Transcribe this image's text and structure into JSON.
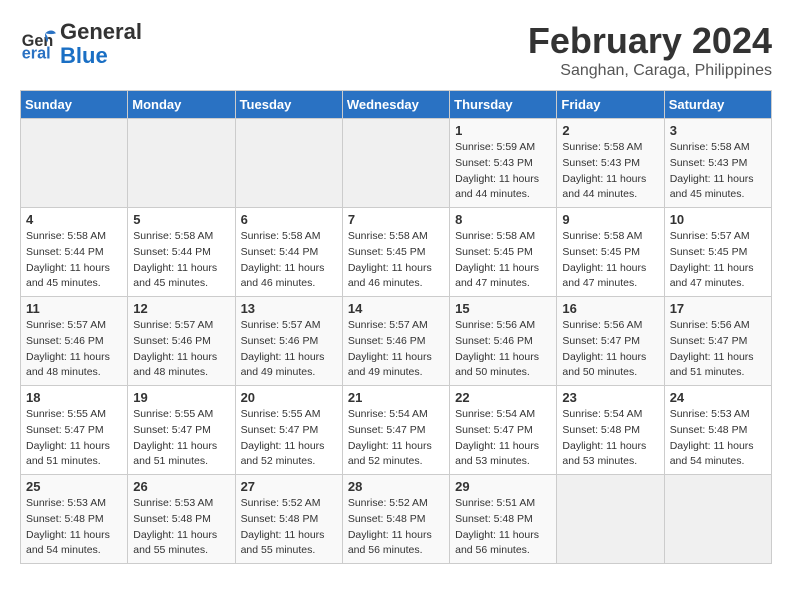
{
  "logo": {
    "text_general": "General",
    "text_blue": "Blue"
  },
  "title": "February 2024",
  "subtitle": "Sanghan, Caraga, Philippines",
  "days_of_week": [
    "Sunday",
    "Monday",
    "Tuesday",
    "Wednesday",
    "Thursday",
    "Friday",
    "Saturday"
  ],
  "weeks": [
    [
      {
        "day": "",
        "info": ""
      },
      {
        "day": "",
        "info": ""
      },
      {
        "day": "",
        "info": ""
      },
      {
        "day": "",
        "info": ""
      },
      {
        "day": "1",
        "info": "Sunrise: 5:59 AM\nSunset: 5:43 PM\nDaylight: 11 hours\nand 44 minutes."
      },
      {
        "day": "2",
        "info": "Sunrise: 5:58 AM\nSunset: 5:43 PM\nDaylight: 11 hours\nand 44 minutes."
      },
      {
        "day": "3",
        "info": "Sunrise: 5:58 AM\nSunset: 5:43 PM\nDaylight: 11 hours\nand 45 minutes."
      }
    ],
    [
      {
        "day": "4",
        "info": "Sunrise: 5:58 AM\nSunset: 5:44 PM\nDaylight: 11 hours\nand 45 minutes."
      },
      {
        "day": "5",
        "info": "Sunrise: 5:58 AM\nSunset: 5:44 PM\nDaylight: 11 hours\nand 45 minutes."
      },
      {
        "day": "6",
        "info": "Sunrise: 5:58 AM\nSunset: 5:44 PM\nDaylight: 11 hours\nand 46 minutes."
      },
      {
        "day": "7",
        "info": "Sunrise: 5:58 AM\nSunset: 5:45 PM\nDaylight: 11 hours\nand 46 minutes."
      },
      {
        "day": "8",
        "info": "Sunrise: 5:58 AM\nSunset: 5:45 PM\nDaylight: 11 hours\nand 47 minutes."
      },
      {
        "day": "9",
        "info": "Sunrise: 5:58 AM\nSunset: 5:45 PM\nDaylight: 11 hours\nand 47 minutes."
      },
      {
        "day": "10",
        "info": "Sunrise: 5:57 AM\nSunset: 5:45 PM\nDaylight: 11 hours\nand 47 minutes."
      }
    ],
    [
      {
        "day": "11",
        "info": "Sunrise: 5:57 AM\nSunset: 5:46 PM\nDaylight: 11 hours\nand 48 minutes."
      },
      {
        "day": "12",
        "info": "Sunrise: 5:57 AM\nSunset: 5:46 PM\nDaylight: 11 hours\nand 48 minutes."
      },
      {
        "day": "13",
        "info": "Sunrise: 5:57 AM\nSunset: 5:46 PM\nDaylight: 11 hours\nand 49 minutes."
      },
      {
        "day": "14",
        "info": "Sunrise: 5:57 AM\nSunset: 5:46 PM\nDaylight: 11 hours\nand 49 minutes."
      },
      {
        "day": "15",
        "info": "Sunrise: 5:56 AM\nSunset: 5:46 PM\nDaylight: 11 hours\nand 50 minutes."
      },
      {
        "day": "16",
        "info": "Sunrise: 5:56 AM\nSunset: 5:47 PM\nDaylight: 11 hours\nand 50 minutes."
      },
      {
        "day": "17",
        "info": "Sunrise: 5:56 AM\nSunset: 5:47 PM\nDaylight: 11 hours\nand 51 minutes."
      }
    ],
    [
      {
        "day": "18",
        "info": "Sunrise: 5:55 AM\nSunset: 5:47 PM\nDaylight: 11 hours\nand 51 minutes."
      },
      {
        "day": "19",
        "info": "Sunrise: 5:55 AM\nSunset: 5:47 PM\nDaylight: 11 hours\nand 51 minutes."
      },
      {
        "day": "20",
        "info": "Sunrise: 5:55 AM\nSunset: 5:47 PM\nDaylight: 11 hours\nand 52 minutes."
      },
      {
        "day": "21",
        "info": "Sunrise: 5:54 AM\nSunset: 5:47 PM\nDaylight: 11 hours\nand 52 minutes."
      },
      {
        "day": "22",
        "info": "Sunrise: 5:54 AM\nSunset: 5:47 PM\nDaylight: 11 hours\nand 53 minutes."
      },
      {
        "day": "23",
        "info": "Sunrise: 5:54 AM\nSunset: 5:48 PM\nDaylight: 11 hours\nand 53 minutes."
      },
      {
        "day": "24",
        "info": "Sunrise: 5:53 AM\nSunset: 5:48 PM\nDaylight: 11 hours\nand 54 minutes."
      }
    ],
    [
      {
        "day": "25",
        "info": "Sunrise: 5:53 AM\nSunset: 5:48 PM\nDaylight: 11 hours\nand 54 minutes."
      },
      {
        "day": "26",
        "info": "Sunrise: 5:53 AM\nSunset: 5:48 PM\nDaylight: 11 hours\nand 55 minutes."
      },
      {
        "day": "27",
        "info": "Sunrise: 5:52 AM\nSunset: 5:48 PM\nDaylight: 11 hours\nand 55 minutes."
      },
      {
        "day": "28",
        "info": "Sunrise: 5:52 AM\nSunset: 5:48 PM\nDaylight: 11 hours\nand 56 minutes."
      },
      {
        "day": "29",
        "info": "Sunrise: 5:51 AM\nSunset: 5:48 PM\nDaylight: 11 hours\nand 56 minutes."
      },
      {
        "day": "",
        "info": ""
      },
      {
        "day": "",
        "info": ""
      }
    ]
  ]
}
